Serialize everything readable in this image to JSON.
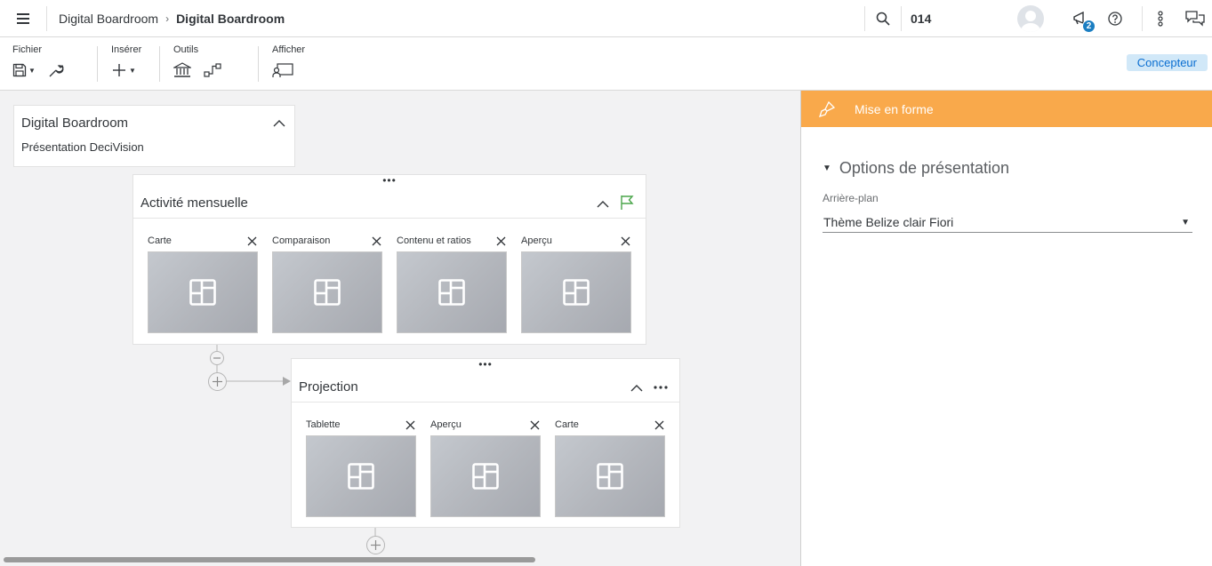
{
  "shell": {
    "breadcrumb_parent": "Digital Boardroom",
    "breadcrumb_current": "Digital Boardroom",
    "context_code": "014",
    "notification_count": "2"
  },
  "toolbar": {
    "file_label": "Fichier",
    "insert_label": "Insérer",
    "tools_label": "Outils",
    "view_label": "Afficher",
    "designer_label": "Concepteur"
  },
  "canvas": {
    "root": {
      "title": "Digital Boardroom",
      "subtitle": "Présentation DeciVision"
    },
    "groups": [
      {
        "title": "Activité mensuelle",
        "tiles": [
          {
            "name": "Carte"
          },
          {
            "name": "Comparaison"
          },
          {
            "name": "Contenu et ratios"
          },
          {
            "name": "Aperçu"
          }
        ]
      },
      {
        "title": "Projection",
        "tiles": [
          {
            "name": "Tablette"
          },
          {
            "name": "Aperçu"
          },
          {
            "name": "Carte"
          }
        ]
      }
    ]
  },
  "panel": {
    "header": "Mise en forme",
    "section_title": "Options de présentation",
    "background_label": "Arrière-plan",
    "background_value": "Thème Belize clair Fiori"
  },
  "colors": {
    "panel_header": "#f9a94b",
    "accent": "#0a6ed1",
    "badge": "#1b7ec2",
    "flag": "#4aa54a"
  }
}
